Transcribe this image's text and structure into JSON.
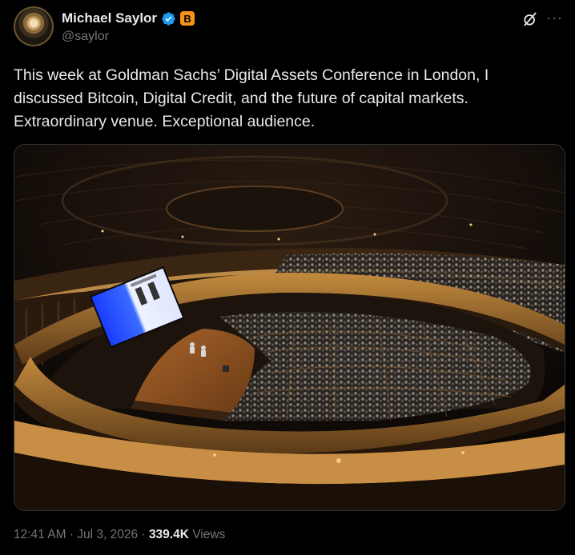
{
  "author": {
    "name": "Michael Saylor",
    "handle": "@saylor",
    "badge_letter": "B",
    "badge_color": "#f7931a",
    "verified_color": "#1d9bf0"
  },
  "tweet": {
    "text": "This week at Goldman Sachs’ Digital Assets Conference in London, I discussed Bitcoin, Digital Credit, and the future of capital markets. Extraordinary venue. Exceptional audience."
  },
  "meta": {
    "time": "12:41 AM",
    "separator": "·",
    "date": "Jul 3, 2026",
    "views_count": "339.4K",
    "views_label": "Views"
  },
  "icons": {
    "grok": "grok-icon",
    "more": "more-options-icon",
    "verified": "verified-badge-icon"
  }
}
